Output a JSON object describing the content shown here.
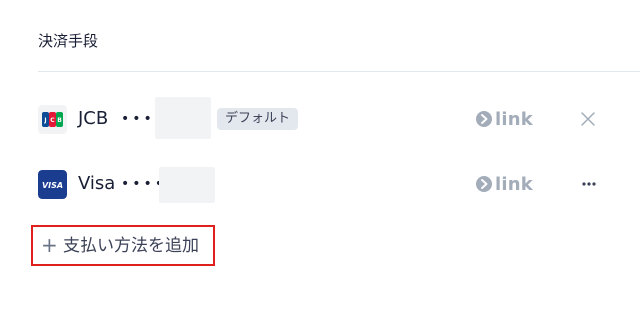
{
  "section": {
    "title": "決済手段"
  },
  "cards": [
    {
      "brand": "JCB",
      "dots": "••••",
      "badge": "デフォルト",
      "link_word": "link",
      "action_icon": "close-icon"
    },
    {
      "brand": "Visa",
      "dots": "••••",
      "link_word": "link",
      "action_icon": "more-icon",
      "logo_text": "VISA"
    }
  ],
  "add_method": {
    "plus": "+",
    "label": "支払い方法を追加"
  },
  "colors": {
    "highlight_border": "#e0201c",
    "visa_blue": "#1a3d8f",
    "muted": "#a3acb9"
  }
}
